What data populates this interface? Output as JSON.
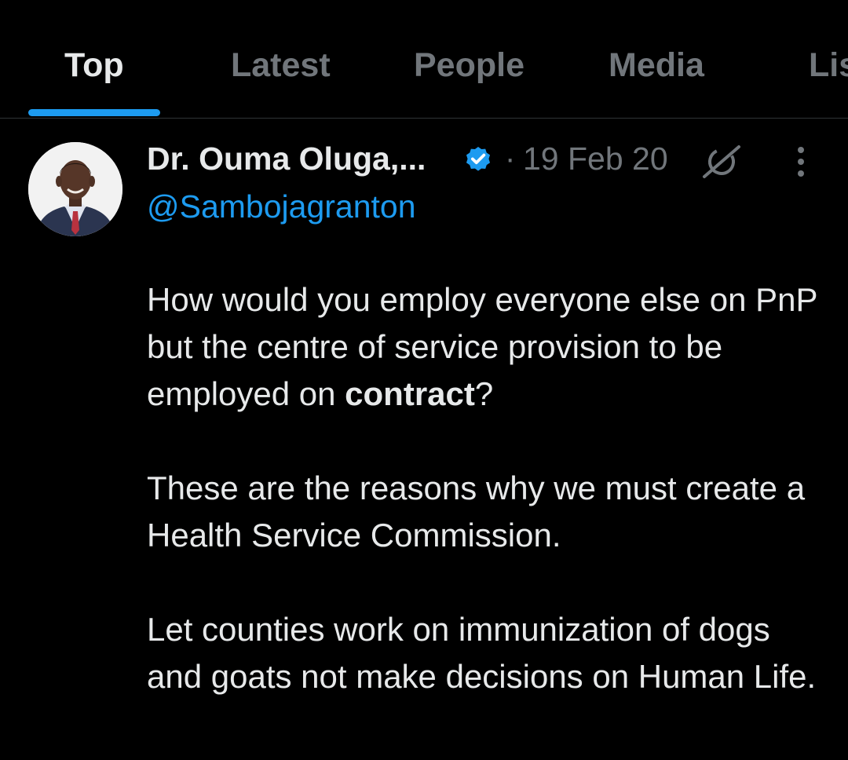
{
  "tabs": [
    {
      "label": "Top",
      "active": true
    },
    {
      "label": "Latest",
      "active": false
    },
    {
      "label": "People",
      "active": false
    },
    {
      "label": "Media",
      "active": false
    },
    {
      "label": "Lists",
      "active": false
    }
  ],
  "tweet": {
    "author": {
      "display_name": "Dr. Ouma Oluga,...",
      "handle": "@Sambojagranton",
      "verified": true
    },
    "separator": "·",
    "timestamp": "19 Feb 20",
    "paragraphs": {
      "p1_before": "How would you employ everyone else on PnP but the centre of service provision to be employed on ",
      "p1_bold": "contract",
      "p1_after": "?",
      "p2": "These are the reasons why we must create a Health Service Commission.",
      "p3": "Let counties work on immunization of dogs and goats not make decisions on Human Life."
    }
  },
  "icons": {
    "verified": "verified-badge-icon",
    "grok": "grok-icon",
    "more": "more-vertical-icon"
  },
  "colors": {
    "background": "#000000",
    "accent": "#1d9bf0",
    "text_primary": "#e7e9ea",
    "text_secondary": "#71767b",
    "divider": "#2f3336"
  }
}
